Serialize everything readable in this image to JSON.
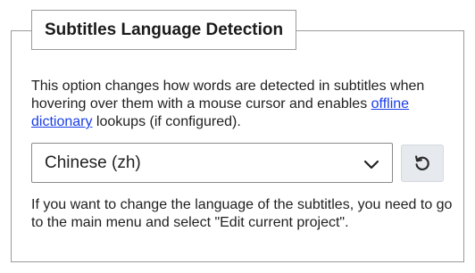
{
  "section": {
    "title": "Subtitles Language Detection"
  },
  "description": {
    "before_link": "This option changes how words are detected in subtitles when hovering over them with a mouse cursor and enables ",
    "link_text": "offline dictionary",
    "after_link": " lookups (if configured)."
  },
  "language_select": {
    "selected": "Chinese (zh)",
    "icon": "chevron-down-icon"
  },
  "reset_button": {
    "icon": "reset-icon"
  },
  "note": "If you want to change the language of the subtitles, you need to go to the main menu and select \"Edit current project\".",
  "colors": {
    "link": "#1a3ee6",
    "button_bg": "#e6e9ee",
    "border": "#9a9a9a"
  }
}
